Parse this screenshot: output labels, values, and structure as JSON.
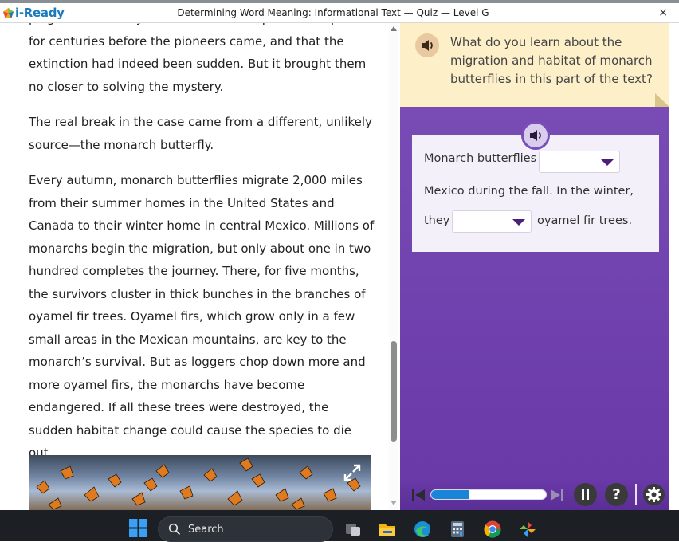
{
  "window": {
    "brand": "i-Ready",
    "title": "Determining Word Meaning: Informational Text — Quiz — Level G",
    "close_glyph": "×"
  },
  "passage": {
    "cutoff_line": "plagues were likely to have been an aspect of the prairies",
    "paragraphs": [
      "for centuries before the pioneers came, and that the extinction had indeed been sudden. But it brought them no closer to solving the mystery.",
      "The real break in the case came from a different, unlikely source—the monarch butterfly.",
      "Every autumn, monarch butterflies migrate 2,000 miles from their summer homes in the United States and Canada to their winter home in central Mexico. Millions of monarchs begin the migration, but only about one in two hundred completes the journey. There, for five months, the survivors cluster in thick bunches in the branches of oyamel fir trees. Oyamel firs, which grow only in a few small areas in the Mexican mountains, are key to the monarch’s survival. But as loggers chop down more and more oyamel firs, the monarchs have become endangered. If all these trees were destroyed, the sudden habitat change could cause the species to die out."
    ],
    "image_icon": "expand-icon"
  },
  "question": {
    "prompt": "What do you learn about the migration and habitat of monarch butterflies in this part of the text?",
    "answer": {
      "segment1": "Monarch butterflies",
      "segment2": "Mexico during the fall. In the winter,",
      "segment3": "they",
      "segment4": "oyamel fir trees.",
      "dropdown1_value": "",
      "dropdown2_value": ""
    }
  },
  "controls": {
    "progress_fraction": 0.33,
    "help_label": "?"
  },
  "taskbar": {
    "search_label": "Search",
    "icons": [
      "windows-start-icon",
      "search-icon",
      "task-view-icon",
      "file-explorer-icon",
      "edge-browser-icon",
      "calculator-icon",
      "chrome-icon",
      "pinwheel-app-icon"
    ]
  },
  "colors": {
    "brand_blue": "#1a7bbd",
    "question_purple": "#6a3aa8",
    "prompt_cream": "#fdf0c9",
    "progress_blue": "#1a84d6"
  }
}
